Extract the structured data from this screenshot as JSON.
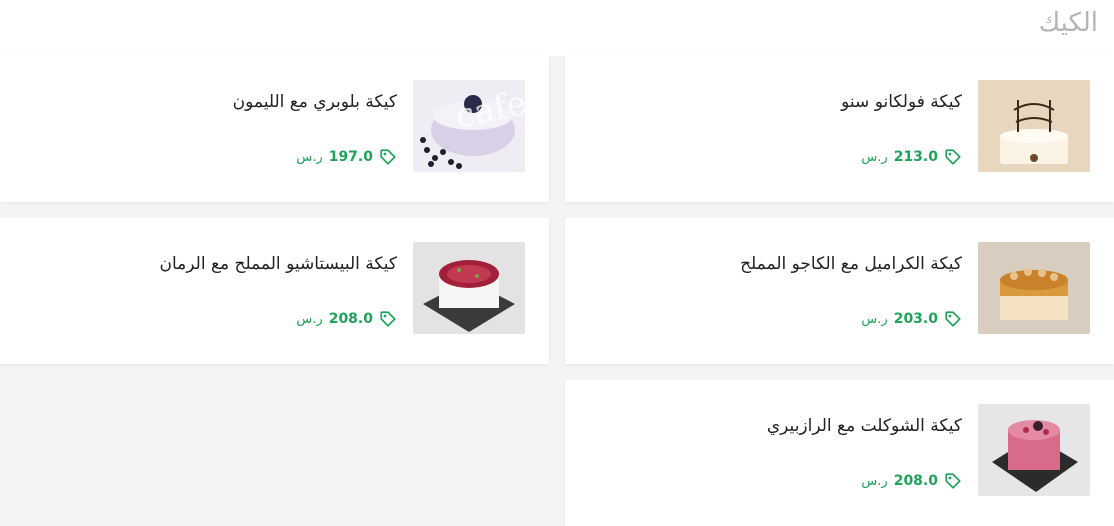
{
  "section": {
    "title": "الكيك"
  },
  "products": [
    {
      "name": "كيكة فولكانو سنو",
      "price": "213.0",
      "currency": "ر.س",
      "image": "cake-with-topper-photo",
      "colors": [
        "#e8d6bf",
        "#fbf3e6",
        "#3a2a1c"
      ]
    },
    {
      "name": "كيكة بلوبري مع الليمون",
      "price": "197.0",
      "currency": "ر.س",
      "image": "blueberry-cake-photo",
      "colors": [
        "#d9d0e8",
        "#f4f1f8",
        "#2a2a4a"
      ]
    },
    {
      "name": "كيكة الكراميل مع الكاجو المملح",
      "price": "203.0",
      "currency": "ر.س",
      "image": "caramel-cake-photo",
      "colors": [
        "#d8cdbf",
        "#d89a3a",
        "#f3e1c2"
      ]
    },
    {
      "name": "كيكة البيستاشيو المملح مع الرمان",
      "price": "208.0",
      "currency": "ر.س",
      "image": "pistachio-pomegranate-cake-photo",
      "colors": [
        "#e3e3e3",
        "#f6f6f4",
        "#a3203a"
      ]
    },
    {
      "name": "كيكة الشوكلت مع الرازبيري",
      "price": "208.0",
      "currency": "ر.س",
      "image": "raspberry-chocolate-cake-photo",
      "colors": [
        "#e6e6e6",
        "#d96b8a",
        "#2b2b2b"
      ]
    }
  ],
  "watermark": "cafe",
  "colors": {
    "accent": "#1fa35a",
    "title": "#b5b5b5",
    "text": "#222222"
  }
}
